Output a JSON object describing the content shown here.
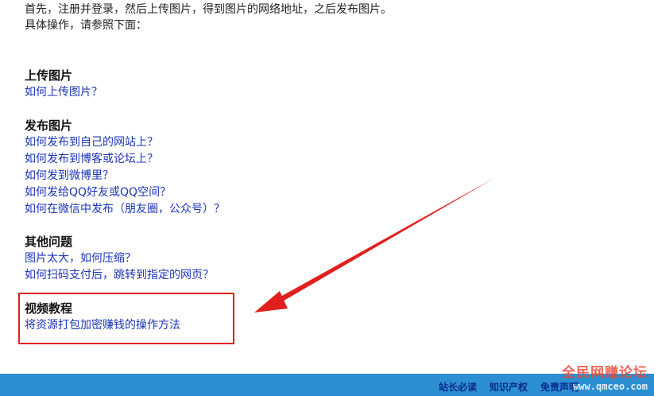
{
  "intro": {
    "line1": "首先，注册并登录，然后上传图片，得到图片的网络地址，之后发布图片。",
    "line2": "具体操作，请参照下面："
  },
  "sections": {
    "upload": {
      "title": "上传图片",
      "links": [
        "如何上传图片？"
      ]
    },
    "publish": {
      "title": "发布图片",
      "links": [
        "如何发布到自己的网站上？",
        "如何发布到博客或论坛上？",
        "如何发到微博里？",
        "如何发给QQ好友或QQ空间？",
        "如何在微信中发布（朋友圈，公众号）？"
      ]
    },
    "other": {
      "title": "其他问题",
      "links": [
        "图片太大，如何压缩？",
        "如何扫码支付后，跳转到指定的网页？"
      ]
    },
    "video": {
      "title": "视频教程",
      "links": [
        "将资源打包加密赚钱的操作方法"
      ]
    }
  },
  "footer": {
    "links": [
      "站长必读",
      "知识产权",
      "免责声明"
    ]
  },
  "watermark": {
    "title": "全民网赚论坛",
    "url": "www.qmceo.com"
  },
  "colors": {
    "link": "#1a35b8",
    "highlight": "#e0201d",
    "footer_bg": "#2b8fd1"
  }
}
